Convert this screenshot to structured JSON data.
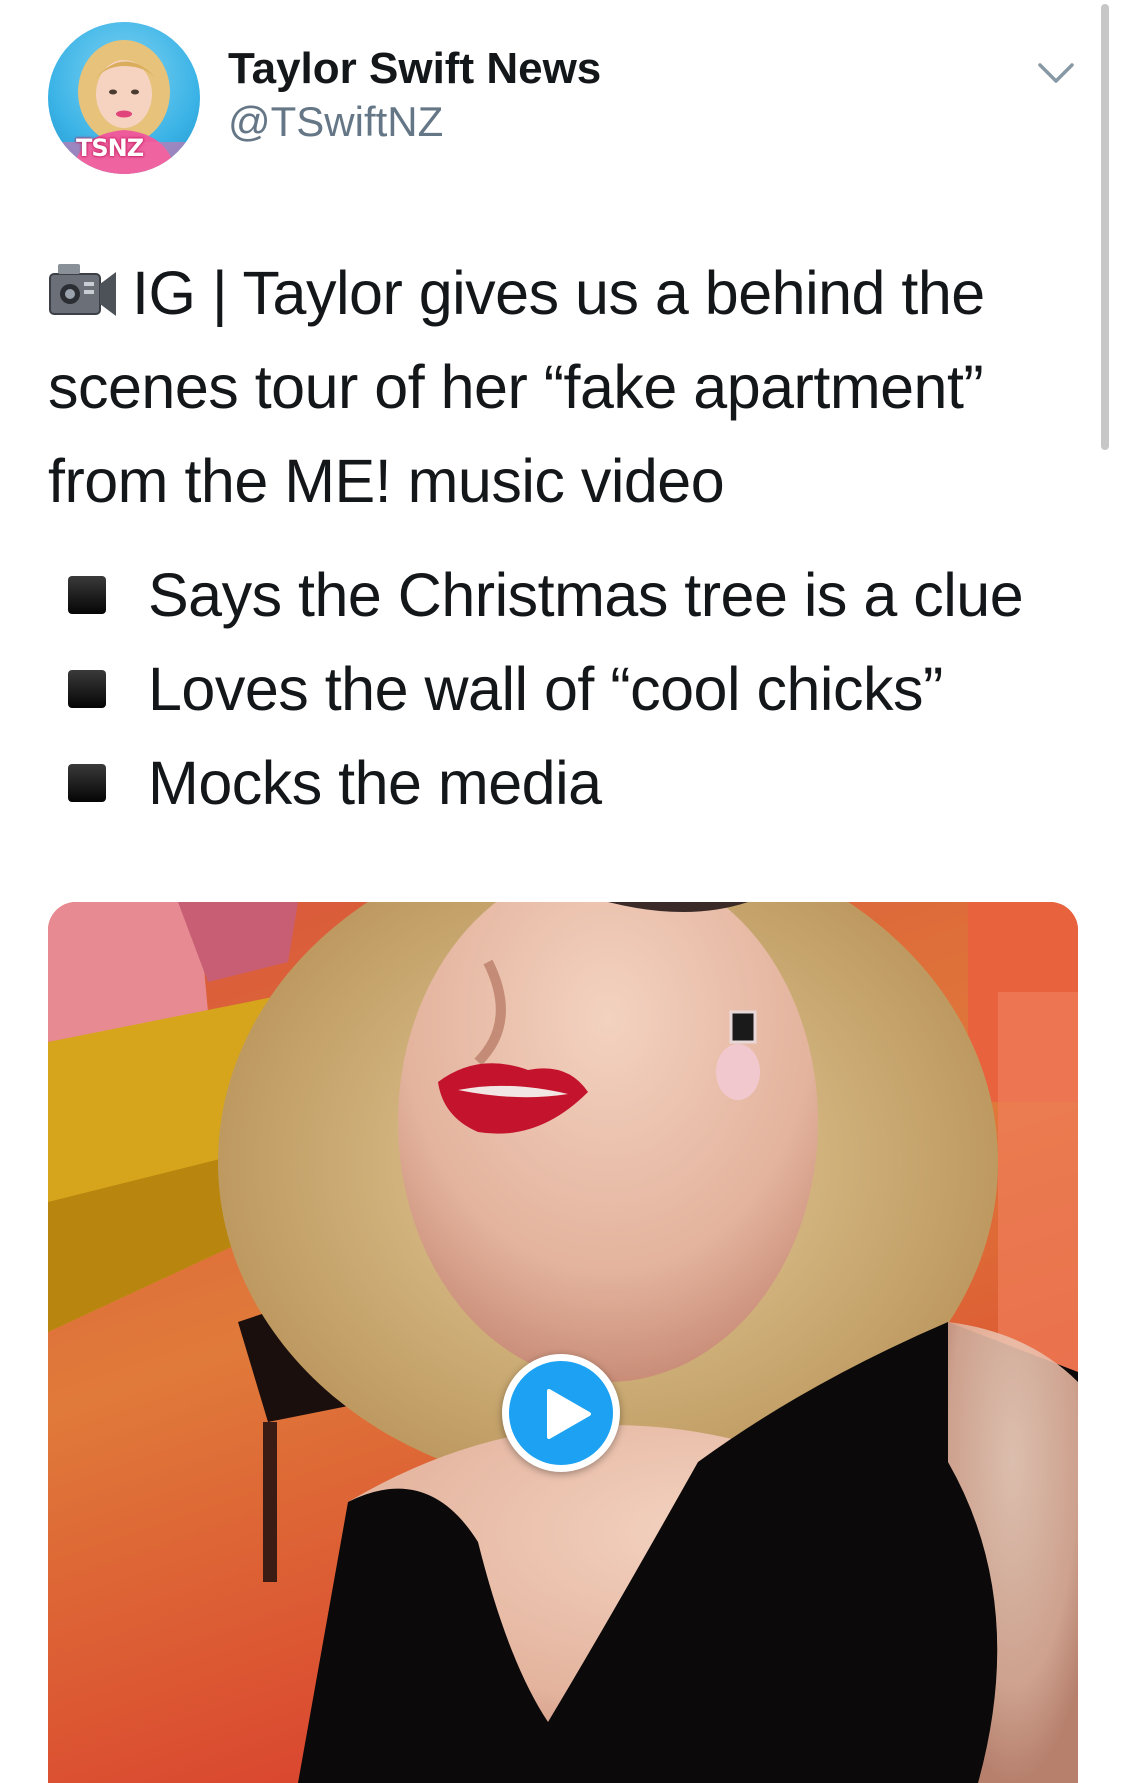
{
  "account": {
    "display_name": "Taylor Swift News",
    "handle": "@TSwiftNZ",
    "avatar_badge": "TSNZ"
  },
  "tweet": {
    "lead_icon": "video-camera-icon",
    "text": "IG | Taylor gives us a behind the scenes tour of her “fake apartment” from the ME! music video",
    "bullets": [
      "Says the Christmas tree is a clue",
      "Loves the wall of “cool chicks”",
      "Mocks the media"
    ]
  },
  "media": {
    "type": "video",
    "play_icon": "play-icon"
  },
  "colors": {
    "accent": "#1da1f2",
    "text": "#14171a",
    "secondary_text": "#657786"
  }
}
